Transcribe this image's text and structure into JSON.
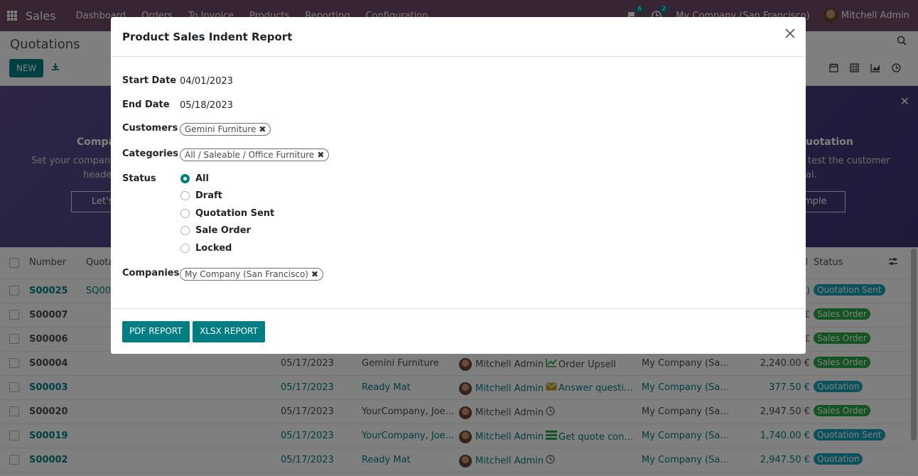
{
  "navbar": {
    "app_name": "Sales",
    "menu": [
      "Dashboard",
      "Orders",
      "To Invoice",
      "Products",
      "Reporting",
      "Configuration"
    ],
    "messages_count": "6",
    "activities_count": "2",
    "company": "My Company (San Francisco)",
    "user": "Mitchell Admin"
  },
  "control_panel": {
    "title": "Quotations",
    "new_label": "NEW"
  },
  "banner": {
    "card1_title": "Compa",
    "card1_line1": "Set your company's",
    "card1_line2": "header",
    "card1_button": "Let's",
    "card2_title": "uotation",
    "card2_line1": "test the customer",
    "card2_line2": "al.",
    "card2_button": "mple"
  },
  "list": {
    "headers": {
      "number": "Number",
      "quotation": "Quota",
      "total": "l",
      "status": "Status"
    },
    "rows": [
      {
        "number": "S00025",
        "quotation": "SQ000",
        "date": "",
        "customer": "",
        "salesperson": "",
        "activity": "",
        "company": "",
        "total": ")",
        "status": "Quotation Sent",
        "status_kind": "sent",
        "link": true
      },
      {
        "number": "S00007",
        "quotation": "",
        "date": "",
        "customer": "",
        "salesperson": "",
        "activity": "",
        "company": "",
        "total": "€",
        "status": "Sales Order",
        "status_kind": "order",
        "link": false
      },
      {
        "number": "S00006",
        "quotation": "",
        "date": "",
        "customer": "",
        "salesperson": "",
        "activity": "",
        "company": "",
        "total": "€",
        "status": "Sales Order",
        "status_kind": "order",
        "link": false
      },
      {
        "number": "S00004",
        "quotation": "",
        "date": "05/17/2023",
        "customer": "Gemini Furniture",
        "salesperson": "Mitchell Admin",
        "activity": "Order Upsell",
        "activity_icon": "chart-up-icon",
        "company": "My Company (San F...",
        "total": "2,240.00 €",
        "status": "Sales Order",
        "status_kind": "order",
        "link": false
      },
      {
        "number": "S00003",
        "quotation": "",
        "date": "05/17/2023",
        "customer": "Ready Mat",
        "salesperson": "Mitchell Admin",
        "activity": "Answer questions",
        "activity_icon": "envelope-icon",
        "company": "My Company (San F...",
        "total": "377.50 €",
        "status": "Quotation",
        "status_kind": "quot",
        "link": true
      },
      {
        "number": "S00020",
        "quotation": "",
        "date": "05/17/2023",
        "customer": "YourCompany, Joel ...",
        "salesperson": "Mitchell Admin",
        "activity": "",
        "activity_icon": "clock-icon",
        "company": "My Company (San F...",
        "total": "2,947.50 €",
        "status": "Sales Order",
        "status_kind": "order",
        "link": false
      },
      {
        "number": "S00019",
        "quotation": "",
        "date": "05/17/2023",
        "customer": "YourCompany, Joel ...",
        "salesperson": "Mitchell Admin",
        "activity": "Get quote confi...",
        "activity_icon": "list-icon",
        "company": "My Company (San F...",
        "total": "1,740.00 €",
        "status": "Quotation Sent",
        "status_kind": "sent",
        "link": true
      },
      {
        "number": "S00002",
        "quotation": "",
        "date": "05/17/2023",
        "customer": "Ready Mat",
        "salesperson": "Mitchell Admin",
        "activity": "",
        "activity_icon": "clock-icon",
        "company": "My Company (San F...",
        "total": "2,947.50 €",
        "status": "Quotation",
        "status_kind": "quot",
        "link": true
      }
    ]
  },
  "modal": {
    "title": "Product Sales Indent Report",
    "start_date_label": "Start Date",
    "start_date": "04/01/2023",
    "end_date_label": "End Date",
    "end_date": "05/18/2023",
    "customers_label": "Customers",
    "customer_tag": "Gemini Furniture",
    "categories_label": "Categories",
    "category_tag": "All / Saleable / Office Furniture",
    "status_label": "Status",
    "status_options": [
      "All",
      "Draft",
      "Quotation Sent",
      "Sale Order",
      "Locked"
    ],
    "status_selected": "All",
    "companies_label": "Companies",
    "company_tag": "My Company (San Francisco)",
    "pdf_button": "PDF REPORT",
    "xlsx_button": "XLSX REPORT"
  },
  "colors": {
    "navbar": "#714b67",
    "primary": "#017e84",
    "overlay": "rgba(0,0,0,0.5)"
  }
}
